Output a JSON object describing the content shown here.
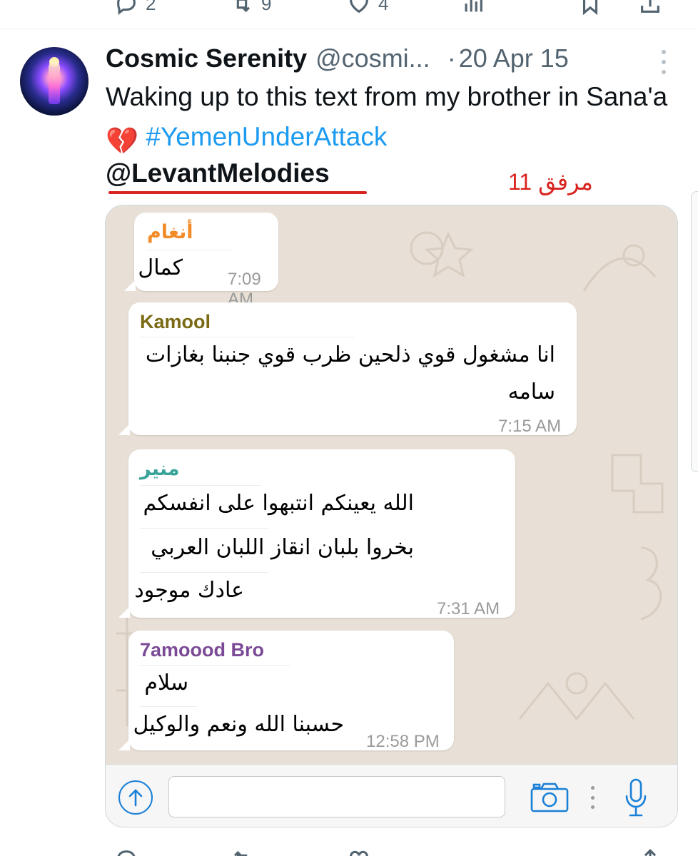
{
  "top_actions": {
    "reply_count": "2",
    "retweet_count": "9",
    "like_count": "4",
    "icons": [
      "reply-icon",
      "retweet-icon",
      "like-icon",
      "views-icon",
      "bookmark-icon",
      "share-icon"
    ]
  },
  "tweet": {
    "author_name": "Cosmic Serenity",
    "author_handle": "@cosmi...",
    "separator": "·",
    "date": "20 Apr 15",
    "text_before": "Waking up to this text from my brother in Sana'a ",
    "emoji": "💔",
    "hashtag": "#YemenUnderAttack",
    "mention": "@LevantMelodies",
    "attachment_label": "مرفق 11",
    "accent_color": "#1d9bf0",
    "annotation_color": "#d8231f"
  },
  "chat": {
    "messages": [
      {
        "sender": "أنغام",
        "sender_color": "#f28c28",
        "lines": [
          "كمال"
        ],
        "time": "7:09 AM"
      },
      {
        "sender": "Kamool",
        "sender_color": "#7a6a14",
        "lines": [
          "انا مشغول قوي ذلحين ظرب قوي جنبنا بغازات",
          "سامه"
        ],
        "time": "7:15 AM"
      },
      {
        "sender": "منير",
        "sender_color": "#3aa39a",
        "lines": [
          "الله يعينكم انتبهوا على انفسكم",
          "بخروا بلبان انقاز اللبان العربي",
          "عادك موجود"
        ],
        "time": "7:31 AM"
      },
      {
        "sender": "7amoood Bro",
        "sender_color": "#7b4a96",
        "lines": [
          "سلام",
          "حسبنا الله ونعم والوكيل"
        ],
        "time": "12:58 PM"
      }
    ],
    "input_value": ""
  }
}
